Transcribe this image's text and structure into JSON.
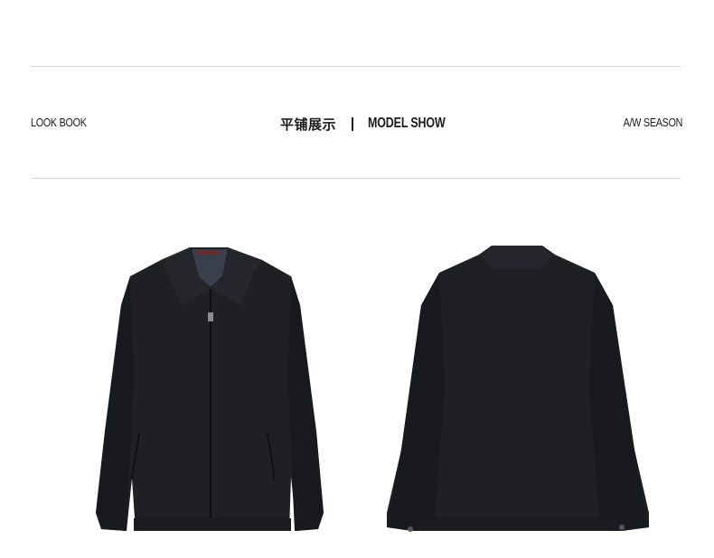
{
  "header": {
    "left_label": "LOOK BOOK",
    "center_cn": "平铺展示",
    "center_en": "MODEL SHOW",
    "right_label": "A/W SEASON"
  },
  "images": {
    "front": {
      "name": "jacket-front-image",
      "color": "#1f2024"
    },
    "back": {
      "name": "jacket-back-image",
      "color": "#1f2024"
    }
  },
  "colors": {
    "rule": "#d4d4d4",
    "text": "#1a1a1a",
    "background": "#ffffff"
  }
}
